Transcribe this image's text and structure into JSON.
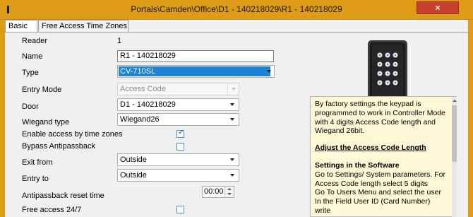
{
  "window": {
    "title": "Portals\\Camden\\Office\\D1 - 140218029\\R1 - 140218029",
    "close_glyph": "×"
  },
  "tabs": [
    {
      "label": "Basic",
      "active": true
    },
    {
      "label": "Free Access Time Zones",
      "active": false
    }
  ],
  "form": {
    "reader": {
      "label": "Reader",
      "value": "1"
    },
    "name": {
      "label": "Name",
      "value": "R1 - 140218029"
    },
    "type": {
      "label": "Type",
      "value": "CV-710SL"
    },
    "entry_mode": {
      "label": "Entry Mode",
      "value": "Access Code"
    },
    "door": {
      "label": "Door",
      "value": "D1 - 140218029"
    },
    "wiegand_type": {
      "label": "Wiegand type",
      "value": "Wiegand26"
    },
    "enable_access": {
      "label": "Enable access by time zones",
      "checked": true
    },
    "bypass": {
      "label": "Bypass Antipassback",
      "checked": false
    },
    "exit_from": {
      "label": "Exit from",
      "value": "Outside"
    },
    "entry_to": {
      "label": "Entry to",
      "value": "Outside"
    },
    "antipassback_reset": {
      "label": "Antipassback reset time",
      "value": "00:00"
    },
    "free_access": {
      "label": "Free access 24/7",
      "checked": false
    }
  },
  "info": {
    "intro": "By factory settings the keypad is programmed to work in Controller Mode with 4 digits Access Code length and Wiegand 26bit.",
    "heading": "Adjust the Access Code Length",
    "subheading": "Settings in the Software",
    "line1": "Go to Settings/ System parameters. For Access Code length select 5 digits",
    "line2": "Go To Users Menu and select the user",
    "line3": "In the Field User ID (Card Number) write"
  },
  "colors": {
    "titlebar": "#de9b16",
    "close": "#c7412f",
    "selection": "#1b82d5",
    "info_background": "#fff7d6"
  },
  "icons": {
    "device_image": "keypad-reader-image",
    "check_mark": "✓"
  }
}
